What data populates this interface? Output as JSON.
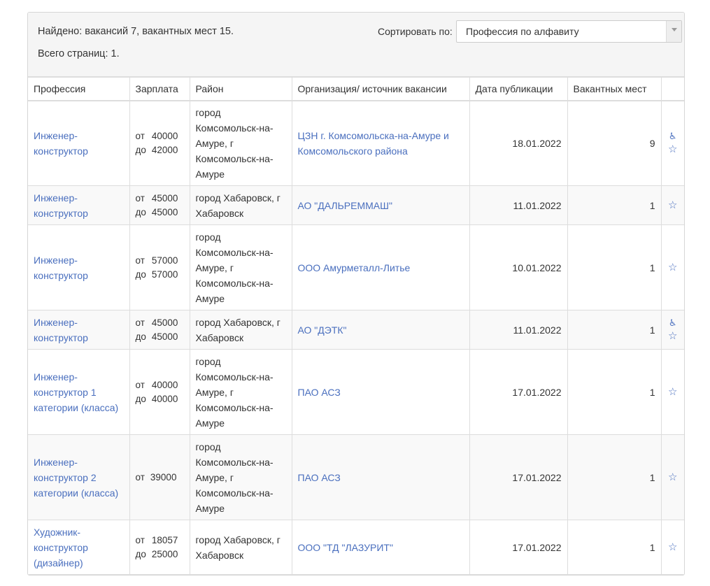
{
  "summary": {
    "found": "Найдено: вакансий 7, вакантных мест 15.",
    "pages": "Всего страниц: 1."
  },
  "sort": {
    "label": "Сортировать по:",
    "value": "Профессия по алфавиту"
  },
  "columns": {
    "profession": "Профессия",
    "salary": "Зарплата",
    "district": "Район",
    "organization": "Организация/ источник вакансии",
    "date": "Дата публикации",
    "count": "Вакантных мест"
  },
  "salary_labels": {
    "from": "от",
    "to": "до"
  },
  "icons": {
    "accessible": "wheelchair-icon",
    "favorite": "star-icon",
    "accessible_glyph": "♿",
    "favorite_glyph": "☆"
  },
  "colors": {
    "link": "#4a6fbe",
    "header_bg": "#f5f5f5",
    "stripe": "#f9f9f9",
    "border": "#dddddd"
  },
  "rows": [
    {
      "profession": "Инженер-конструктор",
      "salary_from": "40000",
      "salary_to": "42000",
      "district": "город Комсомольск-на-Амуре, г Комсомольск-на-Амуре",
      "organization": "ЦЗН г. Комсомольска-на-Амуре и Комсомольского района",
      "date": "18.01.2022",
      "count": "9",
      "accessible": true
    },
    {
      "profession": "Инженер-конструктор",
      "salary_from": "45000",
      "salary_to": "45000",
      "district": "город Хабаровск, г Хабаровск",
      "organization": "АО \"ДАЛЬРЕММАШ\"",
      "date": "11.01.2022",
      "count": "1",
      "accessible": false
    },
    {
      "profession": "Инженер-конструктор",
      "salary_from": "57000",
      "salary_to": "57000",
      "district": "город Комсомольск-на-Амуре, г Комсомольск-на-Амуре",
      "organization": "ООО Амурметалл-Литье",
      "date": "10.01.2022",
      "count": "1",
      "accessible": false
    },
    {
      "profession": "Инженер-конструктор",
      "salary_from": "45000",
      "salary_to": "45000",
      "district": "город Хабаровск, г Хабаровск",
      "organization": "АО \"ДЭТК\"",
      "date": "11.01.2022",
      "count": "1",
      "accessible": true
    },
    {
      "profession": "Инженер-конструктор 1 категории (класса)",
      "salary_from": "40000",
      "salary_to": "40000",
      "district": "город Комсомольск-на-Амуре, г Комсомольск-на-Амуре",
      "organization": "ПАО АСЗ",
      "date": "17.01.2022",
      "count": "1",
      "accessible": false
    },
    {
      "profession": "Инженер-конструктор 2 категории (класса)",
      "salary_from": "39000",
      "salary_to": null,
      "district": "город Комсомольск-на-Амуре, г Комсомольск-на-Амуре",
      "organization": "ПАО АСЗ",
      "date": "17.01.2022",
      "count": "1",
      "accessible": false
    },
    {
      "profession": "Художник-конструктор (дизайнер)",
      "salary_from": "18057",
      "salary_to": "25000",
      "district": "город Хабаровск, г Хабаровск",
      "organization": "ООО \"ТД \"ЛАЗУРИТ\"",
      "date": "17.01.2022",
      "count": "1",
      "accessible": false
    }
  ]
}
